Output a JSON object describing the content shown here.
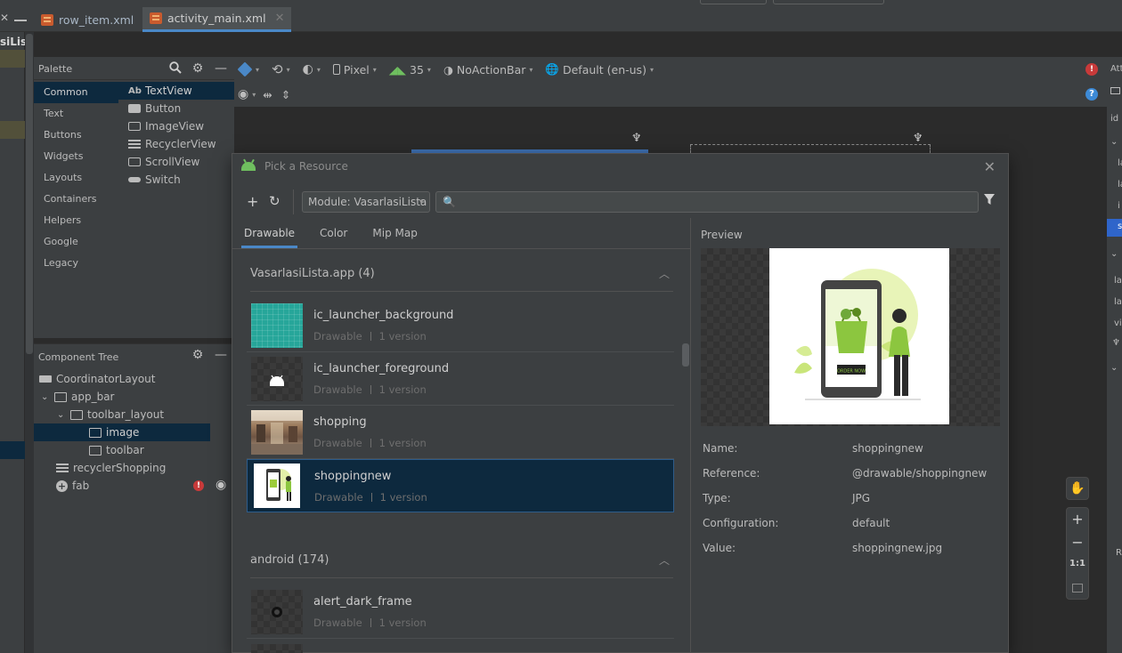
{
  "editor_tabs": [
    {
      "label": "row_item.xml"
    },
    {
      "label": "activity_main.xml"
    }
  ],
  "left_panel": {
    "title": "siList"
  },
  "palette": {
    "title": "Palette",
    "categories": [
      "Common",
      "Text",
      "Buttons",
      "Widgets",
      "Layouts",
      "Containers",
      "Helpers",
      "Google",
      "Legacy"
    ],
    "widgets": [
      "TextView",
      "Button",
      "ImageView",
      "RecyclerView",
      "ScrollView",
      "Switch"
    ],
    "textview_prefix": "Ab"
  },
  "component_tree": {
    "title": "Component Tree",
    "items": [
      "CoordinatorLayout",
      "app_bar",
      "toolbar_layout",
      "image",
      "toolbar",
      "recyclerShopping",
      "fab"
    ]
  },
  "design_toolbar": {
    "device": "Pixel",
    "api": "35",
    "theme": "NoActionBar",
    "locale": "Default (en-us)"
  },
  "attributes": {
    "title": "Att",
    "rows": [
      "id",
      "la",
      "la",
      "i",
      "s",
      "lay",
      "lay",
      "vis",
      "R"
    ]
  },
  "zoom_controls": {
    "fit_label": "1:1"
  },
  "dialog": {
    "title": "Pick a Resource",
    "module": "Module: VasarlasiLista",
    "tabs": [
      "Drawable",
      "Color",
      "Mip Map"
    ],
    "groups": [
      {
        "label": "VasarlasiLista.app (4)"
      },
      {
        "label": "android (174)"
      }
    ],
    "resources": [
      {
        "name": "ic_launcher_background",
        "type": "Drawable",
        "versions": "1 version"
      },
      {
        "name": "ic_launcher_foreground",
        "type": "Drawable",
        "versions": "1 version"
      },
      {
        "name": "shopping",
        "type": "Drawable",
        "versions": "1 version"
      },
      {
        "name": "shoppingnew",
        "type": "Drawable",
        "versions": "1 version"
      },
      {
        "name": "alert_dark_frame",
        "type": "Drawable",
        "versions": "1 version"
      }
    ],
    "preview": {
      "label": "Preview",
      "image_button_text": "ORDER NOW",
      "details": [
        {
          "key": "Name:",
          "value": "shoppingnew"
        },
        {
          "key": "Reference:",
          "value": "@drawable/shoppingnew"
        },
        {
          "key": "Type:",
          "value": "JPG"
        },
        {
          "key": "Configuration:",
          "value": "default"
        },
        {
          "key": "Value:",
          "value": "shoppingnew.jpg"
        }
      ]
    }
  },
  "colors": {
    "accent": "#4a88c7",
    "selection": "#0d293e",
    "error": "#c83a3a",
    "android_green": "#6fbf5f"
  }
}
